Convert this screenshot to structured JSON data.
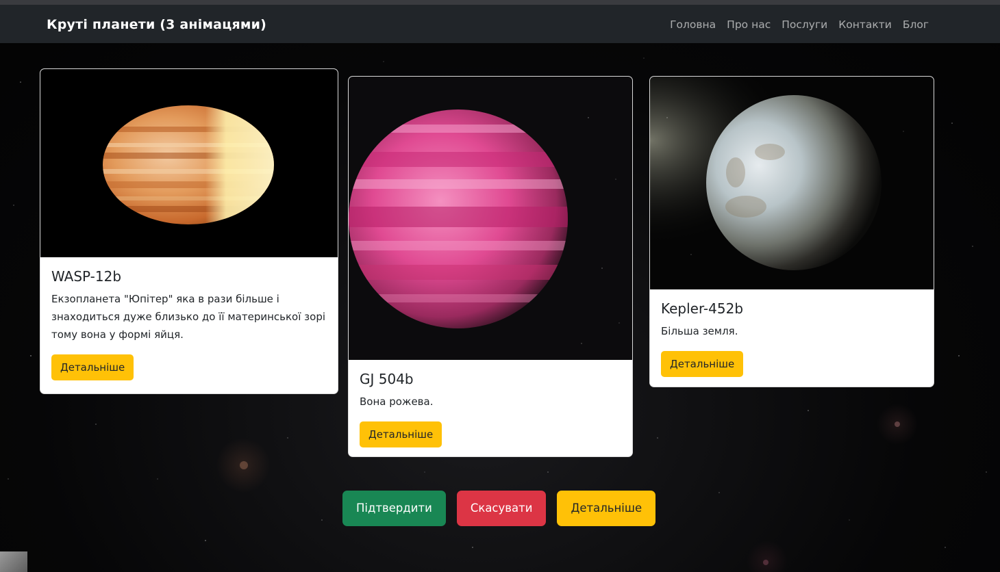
{
  "navbar": {
    "brand": "Круті планети (3 анімацями)",
    "links": [
      "Головна",
      "Про нас",
      "Послуги",
      "Контакти",
      "Блог"
    ]
  },
  "cards": [
    {
      "title": "WASP-12b",
      "text": "Екзопланета \"Юпітер\" яка в рази більше і знаходиться дуже близько до її материнської зорі тому вона у формі яйця.",
      "button": "Детальніше",
      "image_icon": "egg-shaped-orange-planet"
    },
    {
      "title": "GJ 504b",
      "text": "Вона рожева.",
      "button": "Детальніше",
      "image_icon": "pink-gas-planet"
    },
    {
      "title": "Kepler-452b",
      "text": "Більша земля.",
      "button": "Детальніше",
      "image_icon": "earth-like-planet"
    }
  ],
  "actions": {
    "confirm": "Підтвердити",
    "cancel": "Скасувати",
    "details": "Детальніше"
  },
  "colors": {
    "navbar": "#212529",
    "warning": "#ffc107",
    "success": "#198754",
    "danger": "#dc3545"
  }
}
